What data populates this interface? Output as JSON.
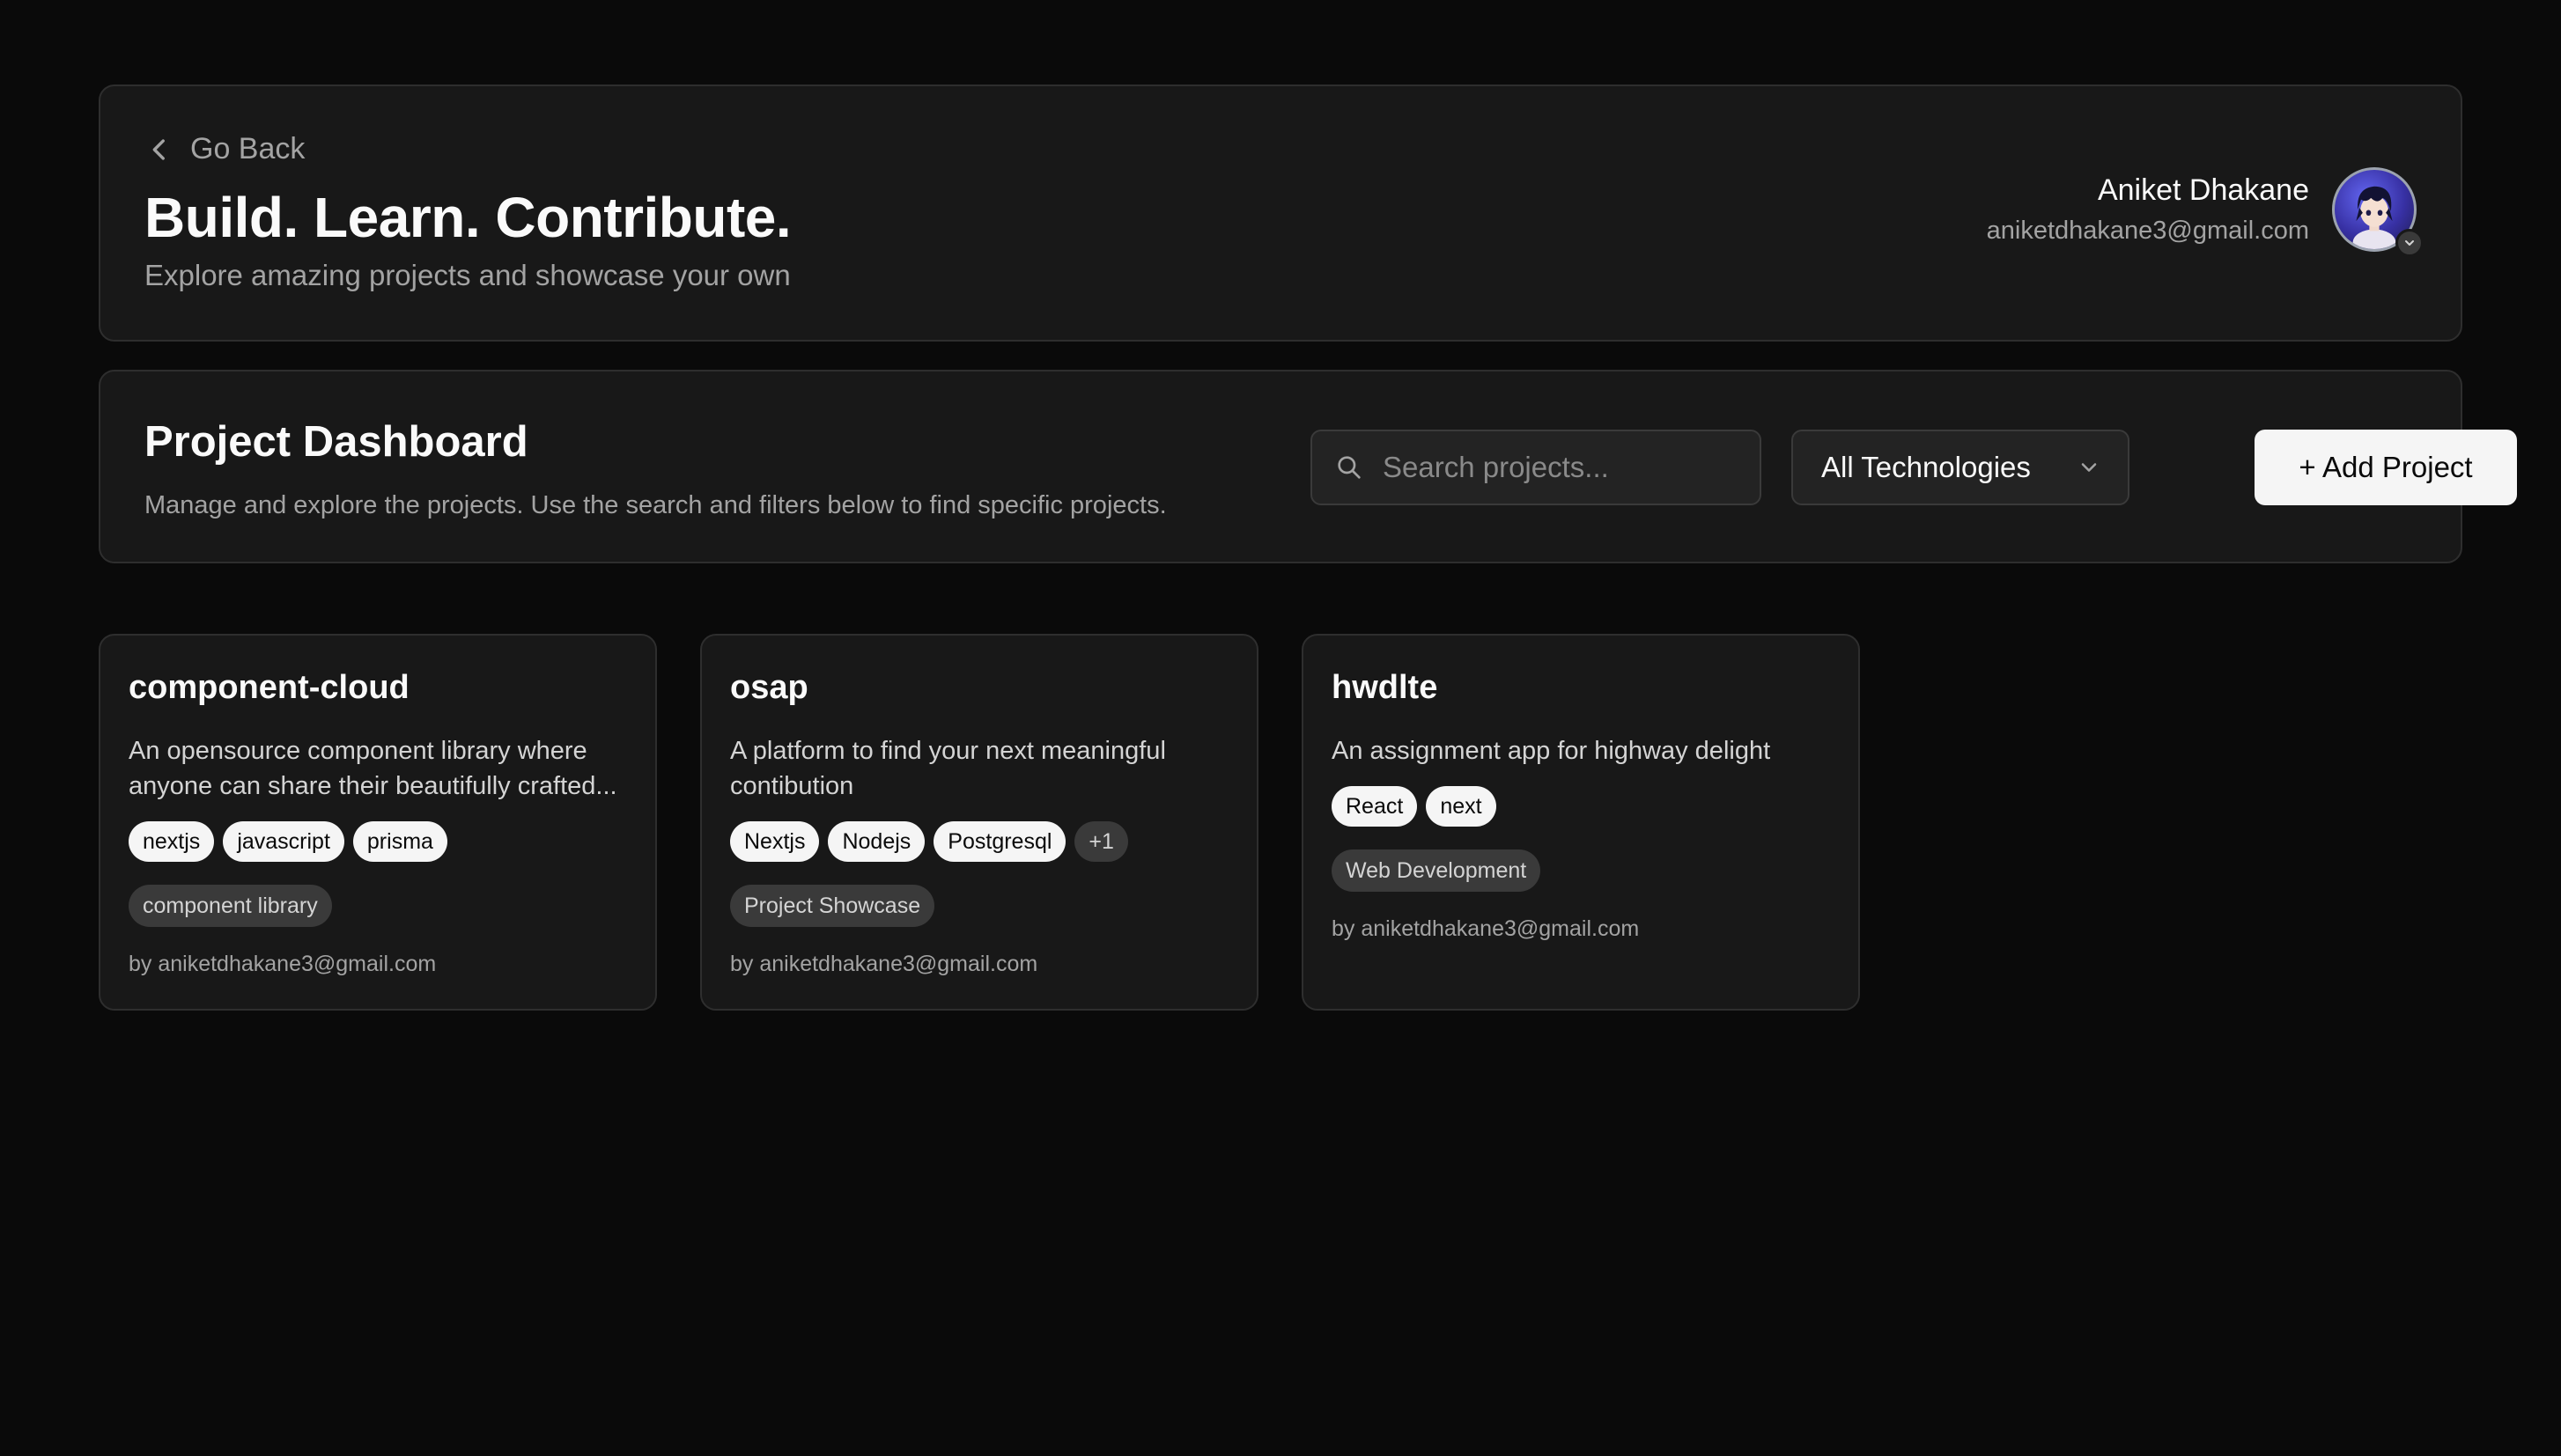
{
  "header": {
    "back_label": "Go Back",
    "title": "Build. Learn. Contribute.",
    "subtitle": "Explore amazing projects and showcase your own",
    "user": {
      "name": "Aniket Dhakane",
      "email": "aniketdhakane3@gmail.com"
    }
  },
  "dashboard": {
    "title": "Project Dashboard",
    "subtitle": "Manage and explore the projects. Use the search and filters below to find specific projects.",
    "search_placeholder": "Search projects...",
    "filter_selected": "All Technologies",
    "add_button": "+ Add Project"
  },
  "projects": [
    {
      "title": "component-cloud",
      "description": "An opensource component library where anyone can share their beautifully crafted...",
      "tags": [
        "nextjs",
        "javascript",
        "prisma"
      ],
      "more": "",
      "category": "component library",
      "author": "by aniketdhakane3@gmail.com"
    },
    {
      "title": "osap",
      "description": "A platform to find your next meaningful contibution",
      "tags": [
        "Nextjs",
        "Nodejs",
        "Postgresql"
      ],
      "more": "+1",
      "category": "Project Showcase",
      "author": "by aniketdhakane3@gmail.com"
    },
    {
      "title": "hwdlte",
      "description": "An assignment app for highway delight",
      "tags": [
        "React",
        "next"
      ],
      "more": "",
      "category": "Web Development",
      "author": "by aniketdhakane3@gmail.com"
    }
  ],
  "icons": {
    "back": "chevron-left-icon",
    "search": "search-icon",
    "select": "chevron-down-icon",
    "avatar_menu": "chevron-down-icon"
  },
  "colors": {
    "background": "#0a0a0a",
    "panel": "#181818",
    "border": "#2e2e2e",
    "primary_button": "#f5f5f5",
    "muted_text": "#a3a3a3"
  }
}
